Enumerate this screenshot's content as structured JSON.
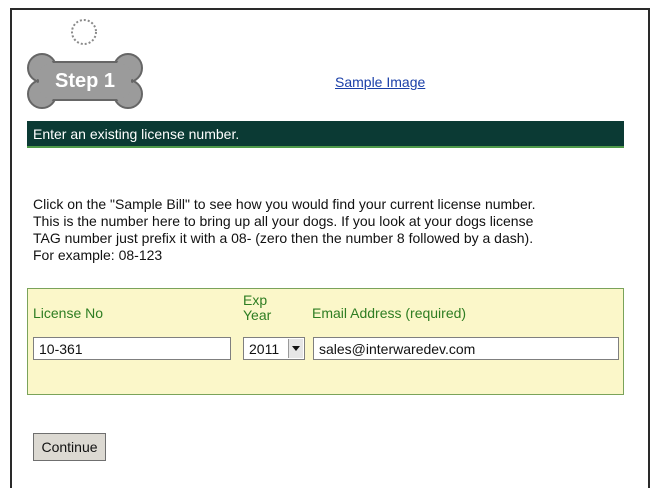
{
  "step_badge": "Step 1",
  "sample_link": "Sample Image",
  "banner_text": "Enter an existing license number.",
  "instructions": [
    "Click on the \"Sample Bill\" to see how you would find your current license number.",
    "This is the number here to bring up all your dogs. If you look at your dogs license",
    "TAG number just prefix it with a 08- (zero then the number 8 followed by a dash).",
    "For example: 08-123"
  ],
  "form": {
    "license_label": "License No",
    "exp_label_line1": "Exp",
    "exp_label_line2": "Year",
    "email_label": "Email Address (required)",
    "license_value": "10-361",
    "year_value": "2011",
    "email_value": "sales@interwaredev.com"
  },
  "continue_label": "Continue",
  "colors": {
    "banner_bg": "#0b3a34",
    "form_bg": "#fbf7c9",
    "label_green": "#2e7d22",
    "link_blue": "#1a3fa8"
  },
  "icons": {
    "step_badge": "dog-bone-tag-icon"
  }
}
